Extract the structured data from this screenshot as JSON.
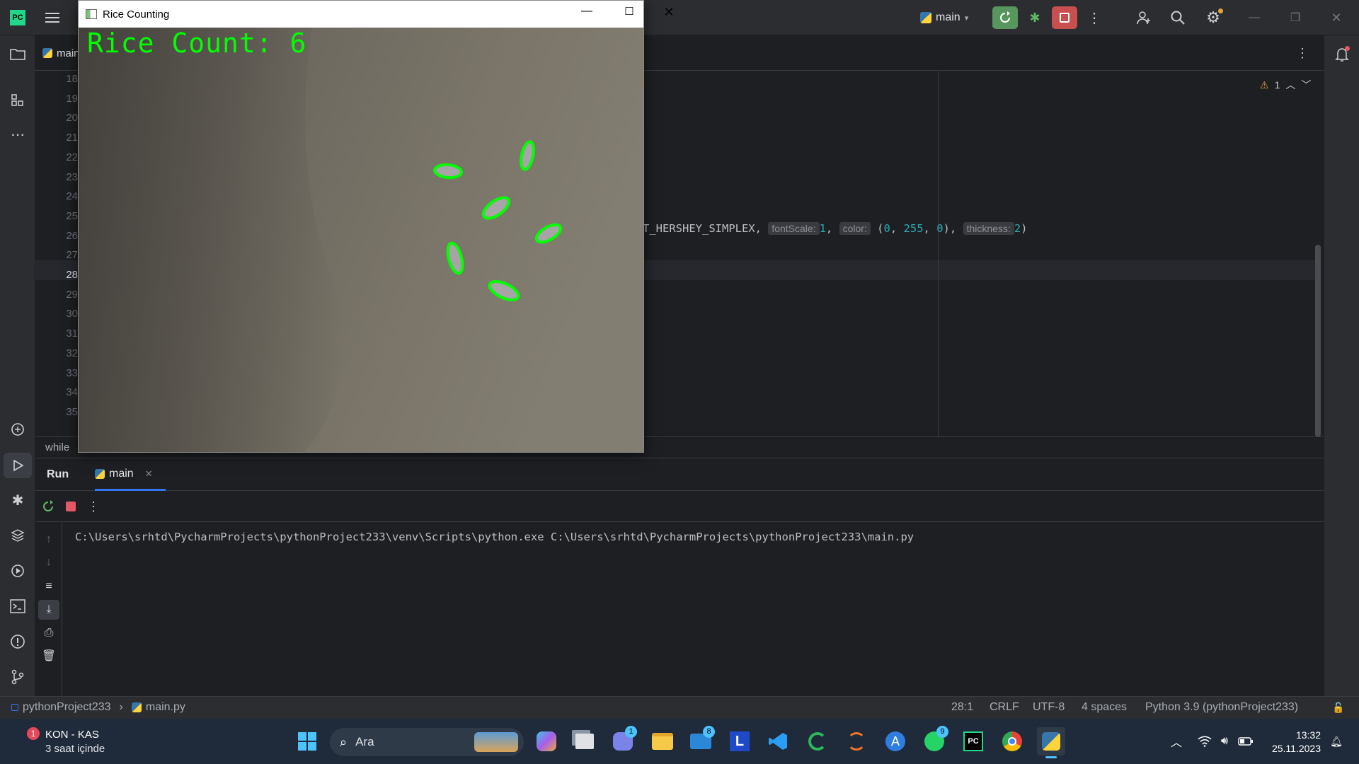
{
  "ide": {
    "branch": "main",
    "editor_tab": "main.py",
    "warning_count": "1",
    "line_numbers": [
      "18",
      "19",
      "20",
      "21",
      "22",
      "23",
      "24",
      "25",
      "26",
      "27",
      "28",
      "29",
      "30",
      "31",
      "32",
      "33",
      "34",
      "35"
    ],
    "current_line": "28",
    "code_line_24": {
      "visible_prefix": "T_HERSHEY_SIMPLEX, ",
      "hint_fontscale": "fontScale:",
      "val_fontscale": "1",
      "hint_color": "color:",
      "val_color_open": "(",
      "val_color_0a": "0",
      "val_color_255": "255",
      "val_color_0b": "0",
      "val_color_close": ")",
      "hint_thickness": "thickness:",
      "val_thickness": "2",
      "close": ")"
    },
    "breadcrumb": "while"
  },
  "run": {
    "tab_run": "Run",
    "tab_main": "main",
    "command": "C:\\Users\\srhtd\\PycharmProjects\\pythonProject233\\venv\\Scripts\\python.exe C:\\Users\\srhtd\\PycharmProjects\\pythonProject233\\main.py"
  },
  "status": {
    "project": "pythonProject233",
    "file": "main.py",
    "position": "28:1",
    "line_sep": "CRLF",
    "encoding": "UTF-8",
    "indent": "4 spaces",
    "interpreter": "Python 3.9 (pythonProject233)"
  },
  "cv_window": {
    "title": "Rice Counting",
    "overlay_text": "Rice Count: 6",
    "overlay_color": "#00ff00"
  },
  "taskbar": {
    "weather_title": "KON - KAS",
    "weather_sub": "3 saat içinde",
    "weather_badge": "1",
    "search_placeholder": "Ara",
    "teams_badge": "1",
    "mail_badge": "8",
    "whatsapp_badge": "9",
    "time": "13:32",
    "date": "25.11.2023"
  }
}
